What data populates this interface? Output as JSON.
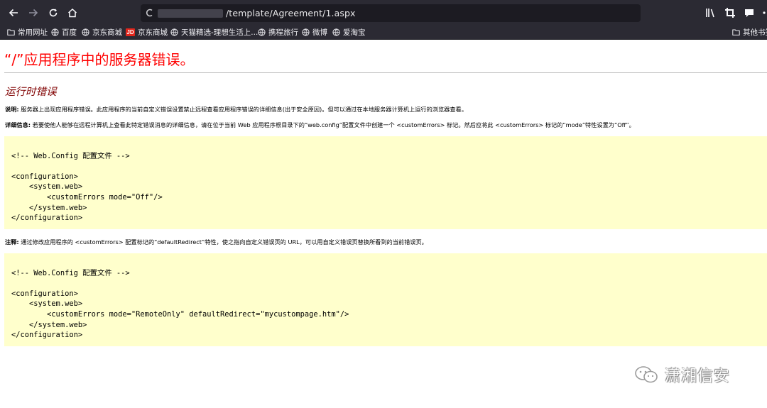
{
  "browser": {
    "url_text": "/template/Agreement/1.aspx",
    "url_prefix_icon": "C"
  },
  "bookmarks": [
    {
      "label": "常用网址",
      "icon": "folder-icon"
    },
    {
      "label": "百度",
      "icon": "globe-icon"
    },
    {
      "label": "京东商城",
      "icon": "globe-icon"
    },
    {
      "label": "京东商城",
      "icon": "jd-logo",
      "logo_text": "JD"
    },
    {
      "label": "天猫精选-理想生活上...",
      "icon": "globe-icon"
    },
    {
      "label": "携程旅行",
      "icon": "globe-icon"
    },
    {
      "label": "微博",
      "icon": "globe-icon"
    },
    {
      "label": "爱淘宝",
      "icon": "globe-icon"
    }
  ],
  "other_bookmarks": "其他书签",
  "page": {
    "error_title": "“/”应用程序中的服务器错误。",
    "runtime_title": "运行时错误",
    "desc_label": "说明:",
    "desc_text": " 服务器上出现应用程序错误。此应用程序的当前自定义错误设置禁止远程查看应用程序错误的详细信息(出于安全原因)。但可以通过在本地服务器计算机上运行的浏览器查看。",
    "detail_label": "详细信息:",
    "detail_text": " 若要使他人能够在远程计算机上查看此特定错误消息的详细信息，请在位于当前 Web 应用程序根目录下的“web.config”配置文件中创建一个 <customErrors> 标记。然后应将此 <customErrors> 标记的“mode”特性设置为“Off”。",
    "code1": "\n<!-- Web.Config 配置文件 -->\n\n<configuration>\n    <system.web>\n        <customErrors mode=\"Off\"/>\n    </system.web>\n</configuration>",
    "note_label": "注释:",
    "note_text": " 通过修改应用程序的 <customErrors> 配置标记的“defaultRedirect”特性，使之指向自定义错误页的 URL，可以用自定义错误页替换所看到的当前错误页。",
    "code2": "\n<!-- Web.Config 配置文件 -->\n\n<configuration>\n    <system.web>\n        <customErrors mode=\"RemoteOnly\" defaultRedirect=\"mycustompage.htm\"/>\n    </system.web>\n</configuration>"
  },
  "watermark": {
    "text": "潇湘信安"
  },
  "colors": {
    "chrome_bg": "#2b2a33",
    "urlbar_bg": "#1c1b22",
    "error_title": "#ff0000",
    "runtime_title": "#800000",
    "code_bg": "#ffffcc"
  }
}
